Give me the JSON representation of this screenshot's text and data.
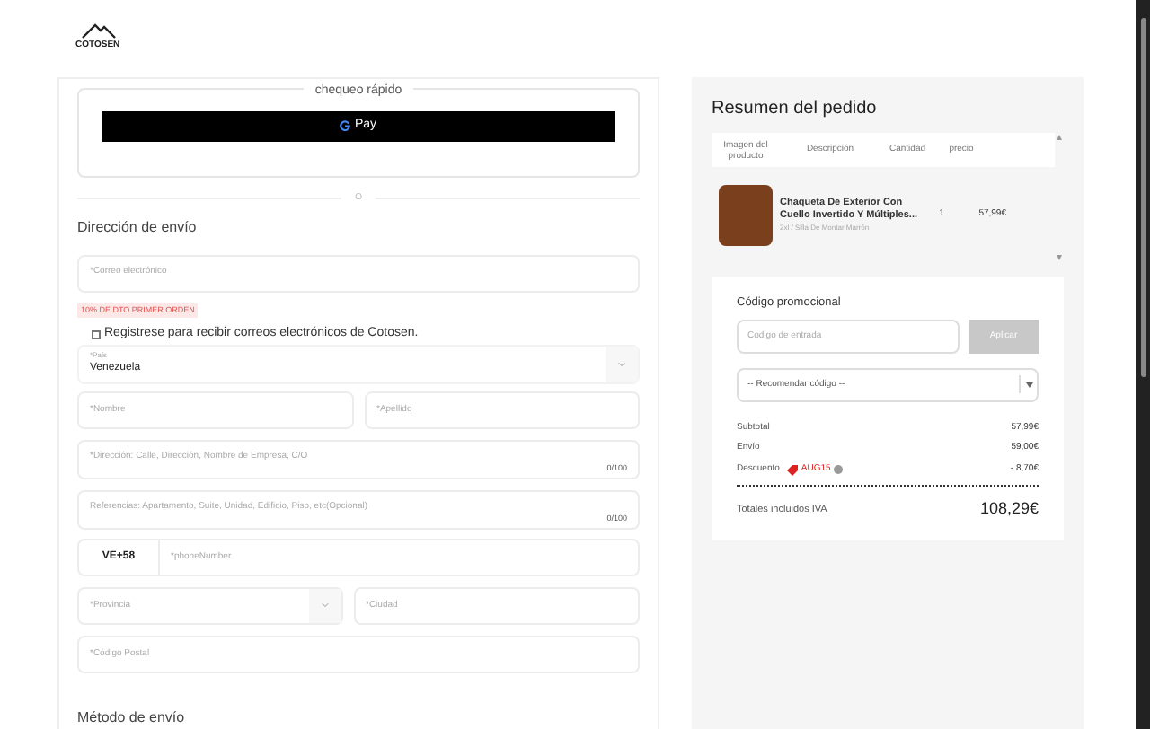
{
  "logo": {
    "text": "COTOSEN"
  },
  "quick_checkout": {
    "title": "chequeo rápido",
    "button": "Pay"
  },
  "divider": "O",
  "shipping": {
    "title": "Dirección de envío",
    "email": {
      "placeholder": "*Correo electrónico"
    },
    "badge": "10% DE DTO PRIMER ORDEN",
    "subscribe": {
      "label": "Registrese para recibir correos electrónicos de Cotosen.",
      "checked": false
    },
    "country": {
      "label": "*País",
      "value": "Venezuela"
    },
    "first_name": {
      "placeholder": "*Nombre"
    },
    "last_name": {
      "placeholder": "*Apellido"
    },
    "address": {
      "placeholder": "*Dirección: Calle, Dirección, Nombre de Empresa, C/O",
      "counter": "0/100"
    },
    "references": {
      "placeholder": "Referencias: Apartamento, Suite, Unidad, Edificio, Piso, etc(Opcional)",
      "counter": "0/100"
    },
    "phone": {
      "prefix": "VE+58",
      "placeholder": "*phoneNumber"
    },
    "province": {
      "placeholder": "*Provincia"
    },
    "city": {
      "placeholder": "*Ciudad"
    },
    "postal": {
      "placeholder": "*Código Postal"
    }
  },
  "shipping_method": {
    "title": "Método de envío"
  },
  "summary": {
    "title": "Resumen del pedido",
    "columns": [
      "Imagen del producto",
      "Descripción",
      "Cantidad",
      "precio"
    ],
    "items": [
      {
        "name": "Chaqueta De Exterior Con Cuello Invertido Y Múltiples...",
        "variant": "2xl / Silla De Montar Marrón",
        "quantity": "1",
        "price": "57,99€"
      }
    ],
    "promo": {
      "title": "Código promocional",
      "placeholder": "Codigo de entrada",
      "apply": "Aplicar",
      "recommend": "-- Recomendar código --"
    },
    "lines": [
      {
        "label": "Subtotal",
        "value": "57,99€",
        "kind": "plain"
      },
      {
        "label": "Envío",
        "value": "59,00€",
        "kind": "plain"
      },
      {
        "label": "Descuento",
        "code": "AUG15",
        "value": "- 8,70€",
        "kind": "discount"
      }
    ],
    "total": {
      "label": "Totales incluidos IVA",
      "value": "108,29€"
    }
  }
}
